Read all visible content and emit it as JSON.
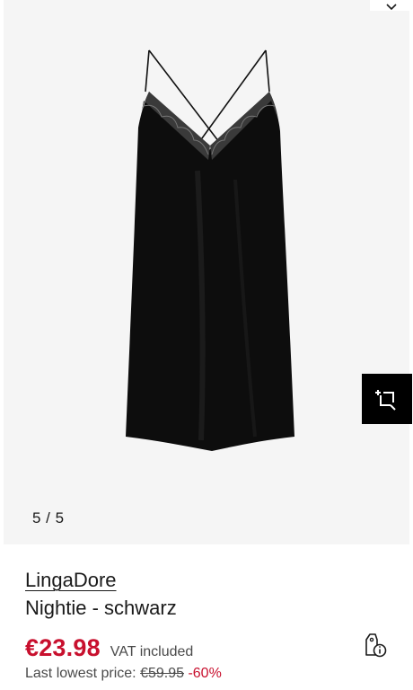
{
  "gallery": {
    "counter": "5 / 5",
    "product_image_icon": "nightie-black-lace-icon",
    "similar_items_icon": "crop-plus-icon",
    "top_corner_icon": "chevron-down-icon"
  },
  "product": {
    "brand": "LingaDore",
    "name": "Nightie - schwarz",
    "price": "€23.98",
    "vat_note": "VAT included",
    "lowest_price_label": "Last lowest price:",
    "old_price": "€59.95",
    "discount": "-60%",
    "price_tag_icon": "price-tag-info-icon"
  },
  "colors": {
    "price_red": "#c8102e",
    "gallery_bg": "#f5f5f5",
    "button_black": "#000000"
  }
}
